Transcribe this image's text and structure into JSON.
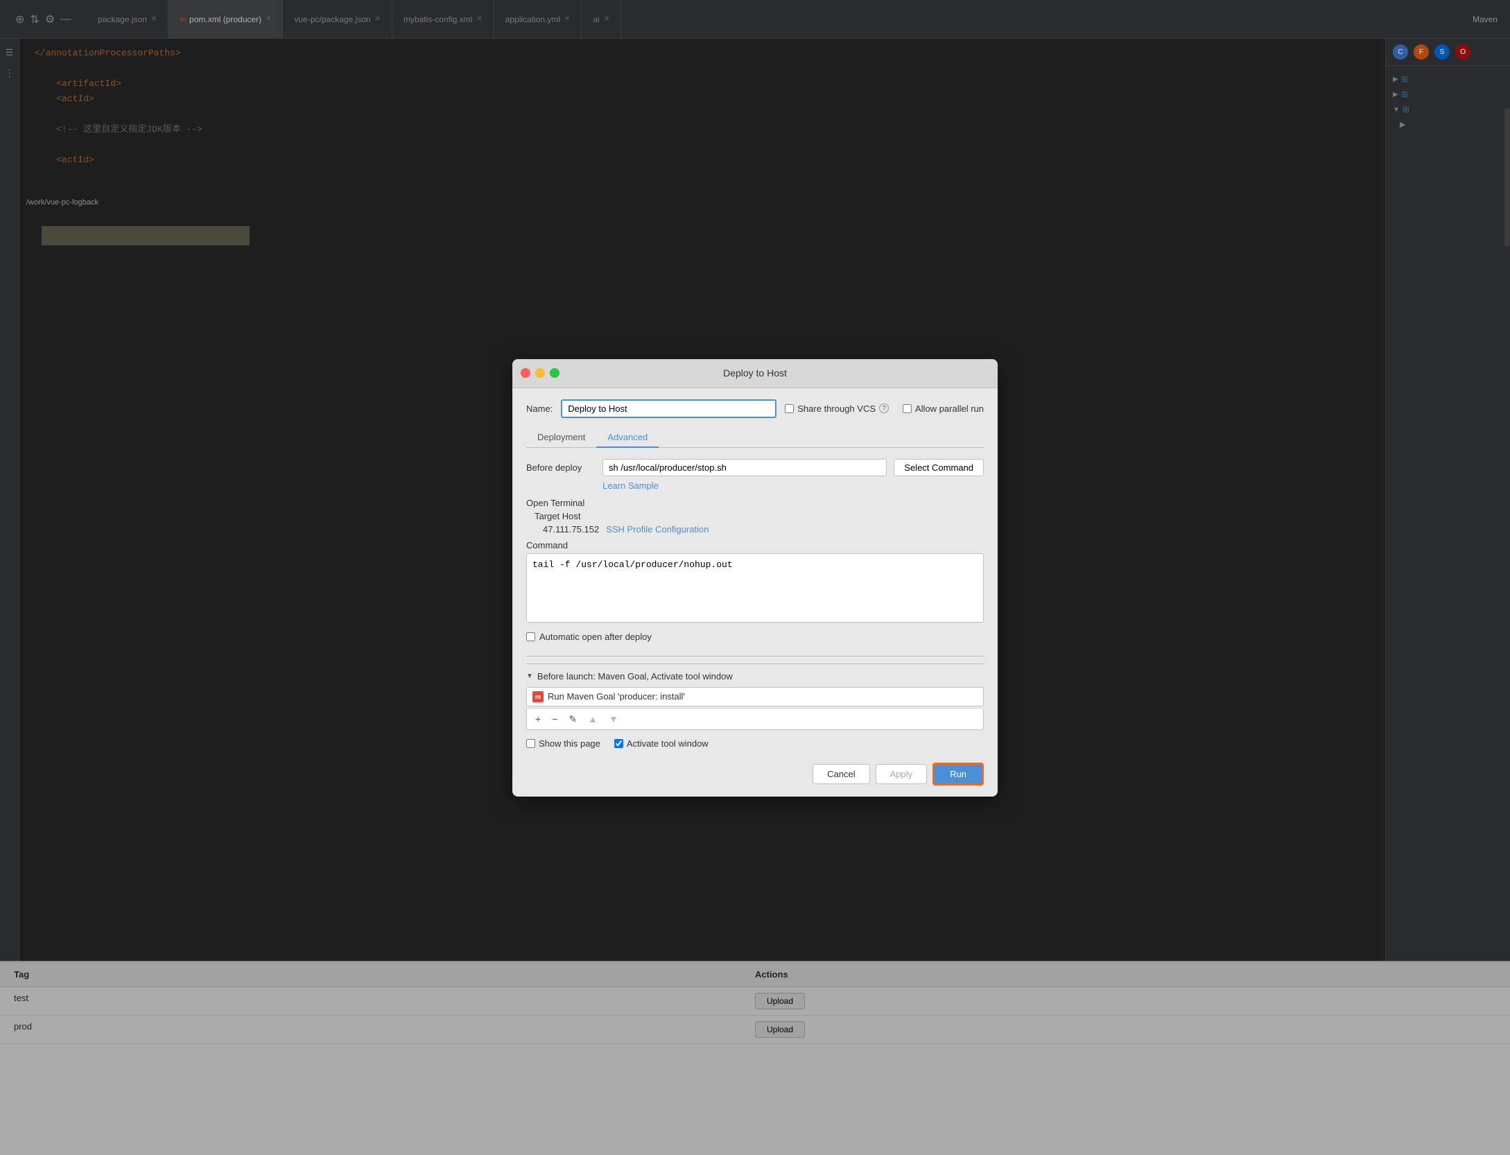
{
  "window": {
    "title": "Deploy to Host"
  },
  "tabs": {
    "items": [
      {
        "label": "package.json",
        "active": false
      },
      {
        "label": "m pom.xml (producer)",
        "active": true
      },
      {
        "label": "vue-pc/package.json",
        "active": false
      },
      {
        "label": "mybatis-config.xml",
        "active": false
      },
      {
        "label": "application.yml",
        "active": false
      },
      {
        "label": "ai",
        "active": false
      }
    ]
  },
  "modal": {
    "title": "Deploy to Host",
    "name_label": "Name:",
    "name_value": "Deploy to Host",
    "share_vcs_label": "Share through VCS",
    "allow_parallel_label": "Allow parallel run",
    "tabs": {
      "deployment": "Deployment",
      "advanced": "Advanced"
    },
    "active_tab": "Advanced",
    "before_deploy_label": "Before deploy",
    "before_deploy_value": "sh /usr/local/producer/stop.sh",
    "select_command_btn": "Select Command",
    "learn_sample": "Learn Sample",
    "open_terminal_label": "Open Terminal",
    "target_host_label": "Target Host",
    "host_ip": "47.111.75.152",
    "ssh_link": "SSH Profile Configuration",
    "command_label": "Command",
    "command_value": "tail -f /usr/local/producer/nohup.out",
    "auto_open_label": "Automatic open after deploy",
    "before_launch_title": "Before launch: Maven Goal, Activate tool window",
    "maven_item": "Run Maven Goal 'producer: install'",
    "show_page_label": "Show this page",
    "activate_window_label": "Activate tool window",
    "cancel_btn": "Cancel",
    "apply_btn": "Apply",
    "run_btn": "Run"
  },
  "ide": {
    "code_lines": [
      "</annotationProcessorPaths>",
      "",
      "<artifactId>",
      "<actId>",
      "",
      "<!-- 这里自定义指定JDK版本 -->",
      "",
      "<actId>"
    ]
  },
  "bottom_table": {
    "col1": "Tag",
    "col2": "Actions",
    "rows": [
      {
        "tag": "test",
        "action": "Upload"
      },
      {
        "tag": "prod",
        "action": "Upload"
      }
    ]
  },
  "sidebar_text": {
    "line1": "/work/vue-pc-logback"
  },
  "maven_label": "Maven"
}
